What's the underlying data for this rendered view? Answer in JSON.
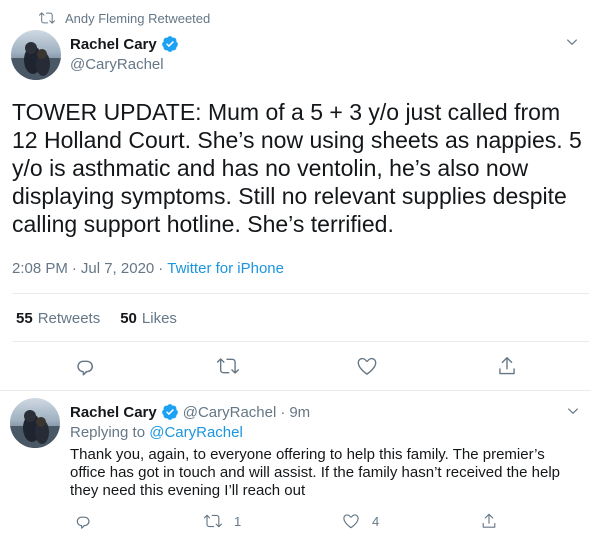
{
  "retweet_context": {
    "icon": "retweet-icon",
    "text": "Andy Fleming Retweeted"
  },
  "tweet": {
    "author_name": "Rachel Cary",
    "author_handle": "@CaryRachel",
    "verified": true,
    "text": "TOWER UPDATE: Mum of a 5 + 3 y/o just called from 12 Holland Court. She’s now using sheets as nappies. 5 y/o is asthmatic and has no ventolin, he’s also now displaying symptoms. Still no relevant supplies despite calling support hotline. She’s terrified.",
    "time": "2:08 PM",
    "separator": "·",
    "date": "Jul 7, 2020",
    "source": "Twitter for iPhone",
    "retweets_count": "55",
    "retweets_label": "Retweets",
    "likes_count": "50",
    "likes_label": "Likes"
  },
  "reply": {
    "author_name": "Rachel Cary",
    "author_handle": "@CaryRachel",
    "separator": "·",
    "time_ago": "9m",
    "replying_to_label": "Replying to",
    "replying_to_handle": "@CaryRachel",
    "text": "Thank you, again, to everyone offering to help this family. The premier’s office has got in touch and will assist. If the family hasn’t received the help they need this evening I’ll reach out",
    "retweets_count": "1",
    "likes_count": "4"
  },
  "colors": {
    "text": "#14171a",
    "secondary": "#657786",
    "link": "#1b95e0",
    "verified": "#1da1f2",
    "divider": "#e6ecf0"
  }
}
